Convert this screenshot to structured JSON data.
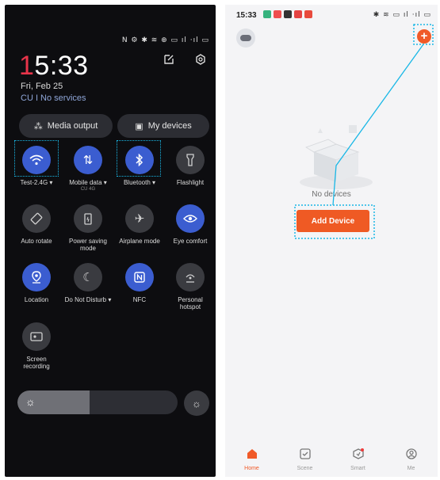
{
  "left_panel": {
    "status_icons": "N ⚙ ✱ ≋ ⊕ ▭ ıl ‧ıl ▭",
    "clock_first_digit": "1",
    "clock_rest": "5:33",
    "date": "Fri, Feb 25",
    "carrier": "CU I No services",
    "media_output_label": "Media output",
    "my_devices_label": "My devices",
    "tiles": [
      {
        "label": "Test-2.4G ▾",
        "sub": "",
        "icon": "wifi-icon",
        "on": true
      },
      {
        "label": "Mobile data ▾",
        "sub": "CU 4G",
        "icon": "mobile-data-icon",
        "on": true
      },
      {
        "label": "Bluetooth ▾",
        "sub": "",
        "icon": "bluetooth-icon",
        "on": true
      },
      {
        "label": "Flashlight",
        "sub": "",
        "icon": "flashlight-icon",
        "on": false
      },
      {
        "label": "Auto rotate",
        "sub": "",
        "icon": "auto-rotate-icon",
        "on": false
      },
      {
        "label": "Power saving mode",
        "sub": "",
        "icon": "power-saving-icon",
        "on": false
      },
      {
        "label": "Airplane mode",
        "sub": "",
        "icon": "airplane-icon",
        "on": false
      },
      {
        "label": "Eye comfort",
        "sub": "",
        "icon": "eye-comfort-icon",
        "on": true
      },
      {
        "label": "Location",
        "sub": "",
        "icon": "location-icon",
        "on": true
      },
      {
        "label": "Do Not Disturb ▾",
        "sub": "",
        "icon": "do-not-disturb-icon",
        "on": false
      },
      {
        "label": "NFC",
        "sub": "",
        "icon": "nfc-icon",
        "on": true
      },
      {
        "label": "Personal hotspot",
        "sub": "",
        "icon": "hotspot-icon",
        "on": false
      },
      {
        "label": "Screen recording",
        "sub": "",
        "icon": "screen-recording-icon",
        "on": false
      }
    ],
    "brightness_level": 0.45
  },
  "right_panel": {
    "time": "15:33",
    "status_icons": "✱ ≋ ▭ ıl ‧ıl ▭",
    "empty_text": "No devices",
    "add_device_label": "Add Device",
    "tabs": [
      {
        "label": "Home",
        "icon": "home-icon",
        "active": true
      },
      {
        "label": "Scene",
        "icon": "scene-icon",
        "active": false
      },
      {
        "label": "Smart",
        "icon": "smart-icon",
        "active": false
      },
      {
        "label": "Me",
        "icon": "me-icon",
        "active": false
      }
    ]
  },
  "colors": {
    "accent_blue": "#3b5dd0",
    "brand_orange": "#f05a28",
    "highlight": "#19b7e6",
    "clock_red": "#e8344a"
  }
}
